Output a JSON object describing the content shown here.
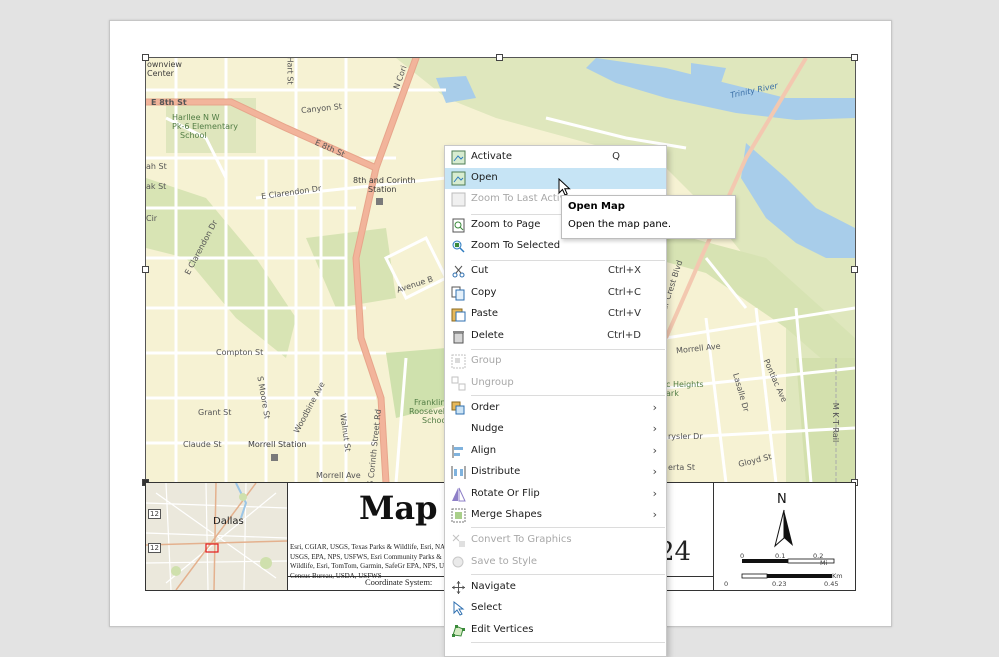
{
  "map": {
    "labels": {
      "e8th_west": "E 8th St",
      "e8th_diag": "E 8th St",
      "canyon": "Canyon St",
      "trinity": "Trinity River",
      "station1": "8th and Corinth",
      "station2": "Station",
      "clarendon": "E Clarendon Dr",
      "clarendon2": "E Clarendon Dr",
      "school1": "Harllee N W",
      "school2": "Pk-6 Elementary",
      "school3": "School",
      "avenue_b": "Avenue B",
      "compton": "Compton St",
      "grant": "Grant St",
      "claude": "Claude St",
      "morrell_station": "Morrell Station",
      "morrell_ave": "Morrell Ave",
      "morrell_ave2": "Morrell Ave",
      "corinth": "S Corinth Street Rd",
      "n_corinth": "N Cori",
      "moore": "S Moore St",
      "woodbine": "Woodbine Ave",
      "walnut": "Walnut St",
      "cedar_crest": "Cedar Crest Blvd",
      "lasalle": "Lasalle Dr",
      "pontiac": "Pontiac Ave",
      "mkt": "M K T Rail",
      "frank1": "Franklin",
      "frank2": "Roosevelt",
      "frank3": "School",
      "heights1": "c Heights",
      "heights2": "ark",
      "rysler": "rysler Dr",
      "gloyd": "Gloyd St",
      "eberta": "erta St",
      "town1": "ownview",
      "town2": "Center",
      "hart": "Hart St",
      "ah": "ah St",
      "cir": "Cir",
      "ak": "ak St"
    },
    "inset": {
      "city": "Dallas",
      "shield1": "12",
      "shield2": "12"
    }
  },
  "layout_text": {
    "title": "Map 7",
    "year_fragment": "24",
    "credits": "Esri, CGIAR, USGS, Texas Parks & Wildlife, Esri, NASA, USGS, EPA, NPS, USFWS, Esri Community Parks & Wildlife, Esri, TomTom, Garmin, SafeGr EPA, NPS, US Census Bureau, USDA, USFWS",
    "coordinate_system": "Coordinate System: "
  },
  "north_arrow": {
    "letter": "N",
    "miles_ticks": [
      "0",
      "0.1",
      "0.2"
    ],
    "miles_unit": "Mi",
    "km_ticks": [
      "0",
      "0.23",
      "0.45"
    ],
    "km_unit": "Km"
  },
  "context_menu": {
    "items": [
      {
        "label": "Activate",
        "shortcut": "Q",
        "icon": "activate-map-icon",
        "disabled": false
      },
      {
        "label": "Open",
        "shortcut": "",
        "icon": "open-map-icon",
        "disabled": false,
        "hover": true
      },
      {
        "label": "Zoom To Last Active",
        "shortcut": "",
        "icon": "zoom-last-active-icon",
        "disabled": true
      },
      {
        "label": "Zoom to Page",
        "shortcut": "",
        "icon": "zoom-to-page-icon",
        "disabled": false
      },
      {
        "label": "Zoom To Selected",
        "shortcut": "",
        "icon": "zoom-to-selected-icon",
        "disabled": false
      },
      {
        "label": "Cut",
        "shortcut": "Ctrl+X",
        "icon": "scissors-icon",
        "disabled": false
      },
      {
        "label": "Copy",
        "shortcut": "Ctrl+C",
        "icon": "copy-icon",
        "disabled": false
      },
      {
        "label": "Paste",
        "shortcut": "Ctrl+V",
        "icon": "paste-icon",
        "disabled": false
      },
      {
        "label": "Delete",
        "shortcut": "Ctrl+D",
        "icon": "trash-icon",
        "disabled": false
      },
      {
        "label": "Group",
        "shortcut": "",
        "icon": "group-icon",
        "disabled": true
      },
      {
        "label": "Ungroup",
        "shortcut": "",
        "icon": "ungroup-icon",
        "disabled": true
      },
      {
        "label": "Order",
        "shortcut": "",
        "icon": "order-icon",
        "disabled": false,
        "submenu": true
      },
      {
        "label": "Nudge",
        "shortcut": "",
        "icon": "",
        "disabled": false,
        "submenu": true
      },
      {
        "label": "Align",
        "shortcut": "",
        "icon": "align-icon",
        "disabled": false,
        "submenu": true
      },
      {
        "label": "Distribute",
        "shortcut": "",
        "icon": "distribute-icon",
        "disabled": false,
        "submenu": true
      },
      {
        "label": "Rotate Or Flip",
        "shortcut": "",
        "icon": "rotate-flip-icon",
        "disabled": false,
        "submenu": true
      },
      {
        "label": "Merge Shapes",
        "shortcut": "",
        "icon": "merge-shapes-icon",
        "disabled": false,
        "submenu": true
      },
      {
        "label": "Convert To Graphics",
        "shortcut": "",
        "icon": "convert-graphics-icon",
        "disabled": true
      },
      {
        "label": "Save to Style",
        "shortcut": "",
        "icon": "save-style-icon",
        "disabled": true
      },
      {
        "label": "Navigate",
        "shortcut": "",
        "icon": "navigate-icon",
        "disabled": false
      },
      {
        "label": "Select",
        "shortcut": "",
        "icon": "select-icon",
        "disabled": false
      },
      {
        "label": "Edit Vertices",
        "shortcut": "",
        "icon": "edit-vertices-icon",
        "disabled": false
      }
    ],
    "submenu_arrow": "›"
  },
  "tooltip": {
    "title": "Open Map",
    "description": "Open the map pane."
  },
  "colors": {
    "hover": "#c6e4f5",
    "road_major": "#f2b49b",
    "water": "#a8cdea",
    "park": "#d3e2b2",
    "map_background": "#f6f2d3"
  }
}
